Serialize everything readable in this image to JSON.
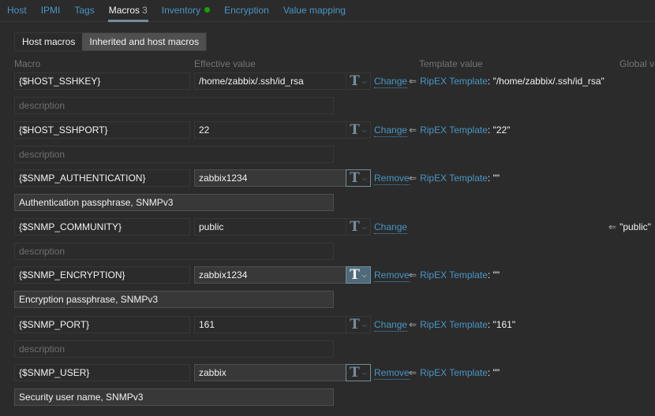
{
  "tabs": [
    {
      "label": "Host",
      "active": false
    },
    {
      "label": "IPMI",
      "active": false
    },
    {
      "label": "Tags",
      "active": false
    },
    {
      "label": "Macros",
      "active": true,
      "count": "3"
    },
    {
      "label": "Inventory",
      "active": false,
      "status_dot": "#17a307"
    },
    {
      "label": "Encryption",
      "active": false
    },
    {
      "label": "Value mapping",
      "active": false
    }
  ],
  "macro_mode": {
    "options": [
      "Host macros",
      "Inherited and host macros"
    ],
    "selected": "Inherited and host macros"
  },
  "columns": {
    "macro": "Macro",
    "effective_value": "Effective value",
    "template_value": "Template value",
    "global_value": "Global va"
  },
  "description_placeholder": "description",
  "value_type_icon": "T",
  "inherit_arrow": "⇐",
  "macros": [
    {
      "macro": "{$HOST_SSHKEY}",
      "value": "/home/zabbix/.ssh/id_rsa",
      "description": "",
      "action": "Change",
      "template_name": "RipEX Template",
      "template_value": "\"/home/zabbix/.ssh/id_rsa\"",
      "global_value": ""
    },
    {
      "macro": "{$HOST_SSHPORT}",
      "value": "22",
      "description": "",
      "action": "Change",
      "template_name": "RipEX Template",
      "template_value": "\"22\"",
      "global_value": ""
    },
    {
      "macro": "{$SNMP_AUTHENTICATION}",
      "value": "zabbix1234",
      "description": "Authentication passphrase, SNMPv3",
      "action": "Remove",
      "template_name": "RipEX Template",
      "template_value": "\"\"",
      "global_value": ""
    },
    {
      "macro": "{$SNMP_COMMUNITY}",
      "value": "public",
      "description": "",
      "action": "Change",
      "template_name": "",
      "template_value": "",
      "global_value": "\"public\""
    },
    {
      "macro": "{$SNMP_ENCRYPTION}",
      "value": "zabbix1234",
      "description": "Encryption passphrase, SNMPv3",
      "action": "Remove",
      "template_name": "RipEX Template",
      "template_value": "\"\"",
      "global_value": ""
    },
    {
      "macro": "{$SNMP_PORT}",
      "value": "161",
      "description": "",
      "action": "Change",
      "template_name": "RipEX Template",
      "template_value": "\"161\"",
      "global_value": ""
    },
    {
      "macro": "{$SNMP_USER}",
      "value": "zabbix",
      "description": "Security user name, SNMPv3",
      "action": "Remove",
      "template_name": "RipEX Template",
      "template_value": "\"\"",
      "global_value": ""
    }
  ]
}
